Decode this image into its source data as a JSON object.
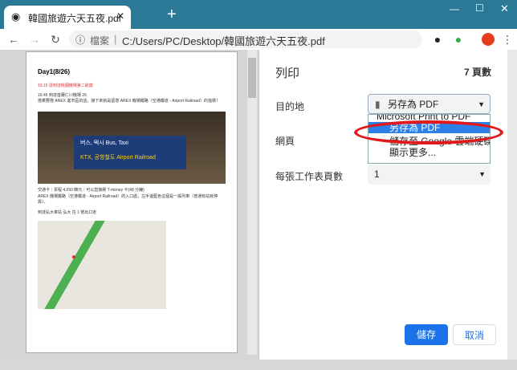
{
  "browser": {
    "tab_title": "韓國旅遊六天五夜.pdf",
    "new_tab": "+",
    "url_label": "檔案",
    "url": "C:/Users/PC/Desktop/韓國旅遊六天五夜.pdf",
    "window_controls": [
      "—",
      "☐",
      "✕"
    ]
  },
  "document": {
    "heading": "Day1(8/26)",
    "line1": "13:15 從到達桃園機場第二航廈",
    "line2": "16:45 到達首爾仁川機場 26",
    "line3": "搭乘要搭 AREX 進市區的話，接下來就是留意 AREX 機場鐵路（空港鐵道 - Airport Railroad）的指標！",
    "photo_sign1": "버스, 택시  Bus, Taxi",
    "photo_sign2": "KTX, 공항철도  Airport Railroad",
    "line4": "交通卡｜票程 4,050 韓元｜可以直接刷 T-money 卡(48 分鐘)",
    "line5": "AREX 機場鐵路（空港鐵道 - Airport Railroad）的入口處，左手邊藍色這個是一般列車（普通有站就停靠）。",
    "line6": "到達弘大車站 弘大 往 1 號出口走"
  },
  "print": {
    "title": "列印",
    "page_count": "7 頁數",
    "destination_label": "目的地",
    "destination_value": "另存為 PDF",
    "pages_label": "網頁",
    "per_sheet_label": "每張工作表頁數",
    "per_sheet_value": "1",
    "options": [
      "Microsoft Print to PDF",
      "另存為 PDF",
      "儲存至 Google 雲端硬碟",
      "顯示更多..."
    ],
    "save": "儲存",
    "cancel": "取消"
  },
  "colors": {
    "accent": "#1a73e8",
    "highlight": "#2d7fea",
    "annotation": "#e0191c",
    "titlebar": "#2b7897"
  }
}
